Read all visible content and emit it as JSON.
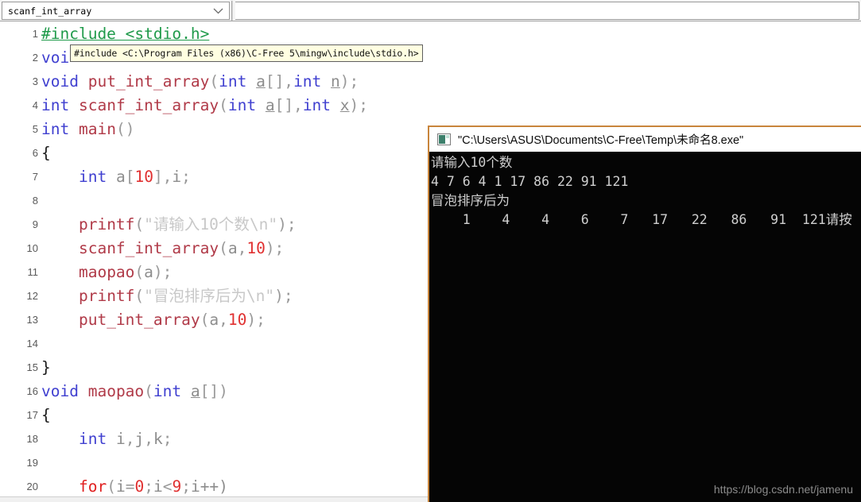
{
  "combo": {
    "value": "scanf_int_array",
    "arrow_icon": "chevron-down-icon"
  },
  "tooltip": {
    "text": "#include <C:\\Program Files (x86)\\C-Free 5\\mingw\\include\\stdio.h>"
  },
  "editor": {
    "lines": [
      {
        "no": "1",
        "tokens": [
          {
            "t": "#include <stdio.h>",
            "c": "t-pre"
          }
        ]
      },
      {
        "no": "2",
        "tokens": [
          {
            "t": "voi",
            "c": "t-kw"
          }
        ]
      },
      {
        "no": "3",
        "tokens": [
          {
            "t": "void",
            "c": "t-kw"
          },
          {
            "t": " ",
            "c": "t-plain"
          },
          {
            "t": "put_int_array",
            "c": "t-fn"
          },
          {
            "t": "(",
            "c": "t-punct"
          },
          {
            "t": "int",
            "c": "t-kw"
          },
          {
            "t": " ",
            "c": "t-plain"
          },
          {
            "t": "a",
            "c": "t-varu"
          },
          {
            "t": "[],",
            "c": "t-punct"
          },
          {
            "t": "int",
            "c": "t-kw"
          },
          {
            "t": " ",
            "c": "t-plain"
          },
          {
            "t": "n",
            "c": "t-varu"
          },
          {
            "t": ");",
            "c": "t-punct"
          }
        ]
      },
      {
        "no": "4",
        "tokens": [
          {
            "t": "int",
            "c": "t-kw"
          },
          {
            "t": " ",
            "c": "t-plain"
          },
          {
            "t": "scanf_int_array",
            "c": "t-fn"
          },
          {
            "t": "(",
            "c": "t-punct"
          },
          {
            "t": "int",
            "c": "t-kw"
          },
          {
            "t": " ",
            "c": "t-plain"
          },
          {
            "t": "a",
            "c": "t-varu"
          },
          {
            "t": "[],",
            "c": "t-punct"
          },
          {
            "t": "int",
            "c": "t-kw"
          },
          {
            "t": " ",
            "c": "t-plain"
          },
          {
            "t": "x",
            "c": "t-varu"
          },
          {
            "t": ");",
            "c": "t-punct"
          }
        ]
      },
      {
        "no": "5",
        "tokens": [
          {
            "t": "int",
            "c": "t-kw"
          },
          {
            "t": " ",
            "c": "t-plain"
          },
          {
            "t": "main",
            "c": "t-fn"
          },
          {
            "t": "()",
            "c": "t-punct"
          }
        ]
      },
      {
        "no": "6",
        "tokens": [
          {
            "t": "{",
            "c": "t-plain"
          }
        ]
      },
      {
        "no": "7",
        "tokens": [
          {
            "t": "    ",
            "c": "t-plain"
          },
          {
            "t": "int",
            "c": "t-kw"
          },
          {
            "t": " ",
            "c": "t-plain"
          },
          {
            "t": "a",
            "c": "t-var"
          },
          {
            "t": "[",
            "c": "t-punct"
          },
          {
            "t": "10",
            "c": "t-num"
          },
          {
            "t": "],",
            "c": "t-punct"
          },
          {
            "t": "i",
            "c": "t-var"
          },
          {
            "t": ";",
            "c": "t-punct"
          }
        ]
      },
      {
        "no": "8",
        "tokens": [
          {
            "t": "",
            "c": "t-plain"
          }
        ]
      },
      {
        "no": "9",
        "tokens": [
          {
            "t": "    ",
            "c": "t-plain"
          },
          {
            "t": "printf",
            "c": "t-fn"
          },
          {
            "t": "(",
            "c": "t-punct"
          },
          {
            "t": "\"请输入10个数\\n\"",
            "c": "t-str"
          },
          {
            "t": ");",
            "c": "t-punct"
          }
        ]
      },
      {
        "no": "10",
        "tokens": [
          {
            "t": "    ",
            "c": "t-plain"
          },
          {
            "t": "scanf_int_array",
            "c": "t-fn"
          },
          {
            "t": "(",
            "c": "t-punct"
          },
          {
            "t": "a",
            "c": "t-var"
          },
          {
            "t": ",",
            "c": "t-punct"
          },
          {
            "t": "10",
            "c": "t-num"
          },
          {
            "t": ");",
            "c": "t-punct"
          }
        ]
      },
      {
        "no": "11",
        "tokens": [
          {
            "t": "    ",
            "c": "t-plain"
          },
          {
            "t": "maopao",
            "c": "t-fn"
          },
          {
            "t": "(",
            "c": "t-punct"
          },
          {
            "t": "a",
            "c": "t-var"
          },
          {
            "t": ");",
            "c": "t-punct"
          }
        ]
      },
      {
        "no": "12",
        "tokens": [
          {
            "t": "    ",
            "c": "t-plain"
          },
          {
            "t": "printf",
            "c": "t-fn"
          },
          {
            "t": "(",
            "c": "t-punct"
          },
          {
            "t": "\"冒泡排序后为\\n\"",
            "c": "t-str"
          },
          {
            "t": ");",
            "c": "t-punct"
          }
        ]
      },
      {
        "no": "13",
        "tokens": [
          {
            "t": "    ",
            "c": "t-plain"
          },
          {
            "t": "put_int_array",
            "c": "t-fn"
          },
          {
            "t": "(",
            "c": "t-punct"
          },
          {
            "t": "a",
            "c": "t-var"
          },
          {
            "t": ",",
            "c": "t-punct"
          },
          {
            "t": "10",
            "c": "t-num"
          },
          {
            "t": ");",
            "c": "t-punct"
          }
        ]
      },
      {
        "no": "14",
        "tokens": [
          {
            "t": "",
            "c": "t-plain"
          }
        ]
      },
      {
        "no": "15",
        "tokens": [
          {
            "t": "}",
            "c": "t-plain"
          }
        ]
      },
      {
        "no": "16",
        "tokens": [
          {
            "t": "void",
            "c": "t-kw"
          },
          {
            "t": " ",
            "c": "t-plain"
          },
          {
            "t": "maopao",
            "c": "t-fn"
          },
          {
            "t": "(",
            "c": "t-punct"
          },
          {
            "t": "int",
            "c": "t-kw"
          },
          {
            "t": " ",
            "c": "t-plain"
          },
          {
            "t": "a",
            "c": "t-varu"
          },
          {
            "t": "[])",
            "c": "t-punct"
          }
        ]
      },
      {
        "no": "17",
        "tokens": [
          {
            "t": "{",
            "c": "t-plain"
          }
        ]
      },
      {
        "no": "18",
        "tokens": [
          {
            "t": "    ",
            "c": "t-plain"
          },
          {
            "t": "int",
            "c": "t-kw"
          },
          {
            "t": " ",
            "c": "t-plain"
          },
          {
            "t": "i",
            "c": "t-var"
          },
          {
            "t": ",",
            "c": "t-punct"
          },
          {
            "t": "j",
            "c": "t-var"
          },
          {
            "t": ",",
            "c": "t-punct"
          },
          {
            "t": "k",
            "c": "t-var"
          },
          {
            "t": ";",
            "c": "t-punct"
          }
        ]
      },
      {
        "no": "19",
        "tokens": [
          {
            "t": "",
            "c": "t-plain"
          }
        ]
      },
      {
        "no": "20",
        "tokens": [
          {
            "t": "    ",
            "c": "t-plain"
          },
          {
            "t": "for",
            "c": "t-ctrl"
          },
          {
            "t": "(",
            "c": "t-punct"
          },
          {
            "t": "i",
            "c": "t-var"
          },
          {
            "t": "=",
            "c": "t-punct"
          },
          {
            "t": "0",
            "c": "t-num"
          },
          {
            "t": ";",
            "c": "t-punct"
          },
          {
            "t": "i",
            "c": "t-var"
          },
          {
            "t": "<",
            "c": "t-punct"
          },
          {
            "t": "9",
            "c": "t-num"
          },
          {
            "t": ";",
            "c": "t-punct"
          },
          {
            "t": "i++)",
            "c": "t-var"
          }
        ]
      }
    ]
  },
  "console": {
    "icon": "console-window-icon",
    "title": "\"C:\\Users\\ASUS\\Documents\\C-Free\\Temp\\未命名8.exe\"",
    "output": [
      "请输入10个数",
      "4 7 6 4 1 17 86 22 91 121",
      "冒泡排序后为",
      "    1    4    4    6    7   17   22   86   91  121请按"
    ]
  },
  "watermark": {
    "text": "https://blog.csdn.net/jamenu"
  },
  "colors": {
    "console_border": "#c8853c",
    "preprocessor": "#1f9a4a",
    "keyword": "#4040d0",
    "function": "#b03a48",
    "number": "#e03030",
    "tooltip_bg": "#fffee1"
  }
}
